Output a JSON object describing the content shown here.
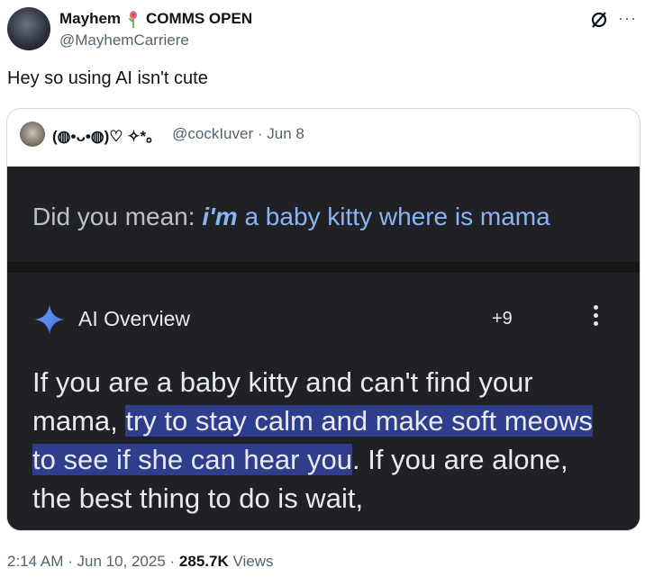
{
  "author": {
    "display_name": "Mayhem",
    "badge": "COMMS OPEN",
    "handle": "@MayhemCarriere"
  },
  "tweet": {
    "text": "Hey so using AI isn't cute"
  },
  "quote": {
    "display_name": "(◍•ᴗ•◍)♡ ✧*。",
    "handle": "@cockIuver",
    "sep": "·",
    "date": "Jun 8",
    "search": {
      "did_you_mean": "Did you mean: ",
      "suggest_em": "i'm",
      "suggest_rest": " a baby kitty where is mama"
    },
    "ai_overview": {
      "title": "AI Overview",
      "count": "+9",
      "body_1": "If you are a baby kitty and can't find your mama, ",
      "body_highlight": "try to stay calm and make soft meows to see if she can hear you",
      "body_2": ". If you are alone, the best thing to do is wait,"
    }
  },
  "meta": {
    "time": "2:14 AM",
    "sep1": " · ",
    "date": "Jun 10, 2025",
    "sep2": " · ",
    "views_count": "285.7K",
    "views_label": " Views"
  },
  "icons": {
    "flower": "rose-icon",
    "grok": "grok-icon",
    "more": "more-icon",
    "sparkle": "sparkle-icon",
    "kebab": "kebab-menu-icon"
  },
  "colors": {
    "link": "#8ab4f8",
    "highlight": "#2f3e8c",
    "dark_bg": "#202124",
    "secondary_text": "#536471"
  }
}
